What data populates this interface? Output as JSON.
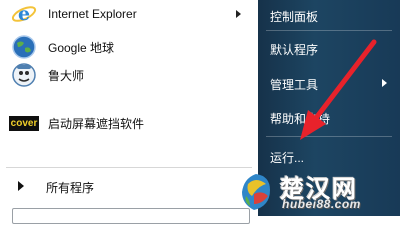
{
  "programs": [
    {
      "label": "Internet Explorer",
      "icon": "internet-explorer-icon",
      "has_submenu": true
    },
    {
      "label": "Google 地球",
      "icon": "google-earth-icon",
      "has_submenu": false
    },
    {
      "label": "鲁大师",
      "icon": "ludashi-icon",
      "has_submenu": false
    },
    {
      "label": "启动屏幕遮挡软件",
      "icon": "cover-app-icon",
      "icon_text": "cover",
      "has_submenu": false
    }
  ],
  "all_programs_label": "所有程序",
  "right_menu": [
    {
      "label": "控制面板",
      "has_submenu": false
    },
    {
      "label": "默认程序",
      "has_submenu": false
    },
    {
      "label": "管理工具",
      "has_submenu": true
    },
    {
      "label": "帮助和支持",
      "has_submenu": false
    },
    {
      "label": "运行...",
      "has_submenu": false
    }
  ],
  "watermark": {
    "title": "楚汉网",
    "url": "hubei88.com"
  },
  "colors": {
    "right_panel": "#1d4562",
    "arrow": "#e8222b",
    "menu_text": "#111111"
  }
}
